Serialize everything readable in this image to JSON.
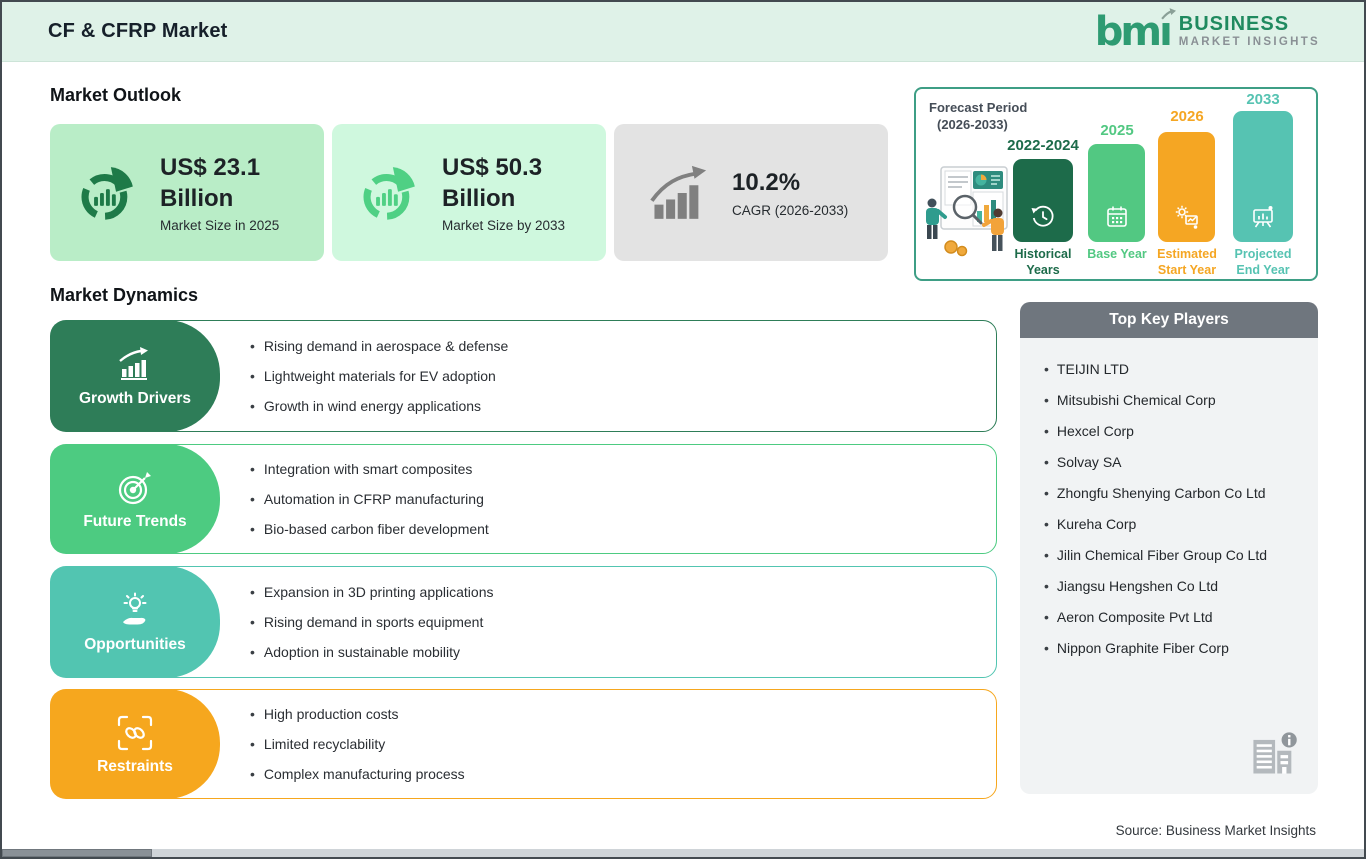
{
  "header": {
    "title": "CF & CFRP Market",
    "logo": {
      "mark": "bm",
      "mark_i": "ı",
      "line1": "BUSINESS",
      "line2": "MARKET INSIGHTS"
    }
  },
  "market_outlook": {
    "heading": "Market Outlook",
    "cards": [
      {
        "value": "US$ 23.1 Billion",
        "label": "Market Size in 2025",
        "bg": "#B9EDC7",
        "icon": "donut-bars-icon",
        "icon_color": "#1E7A48"
      },
      {
        "value": "US$ 50.3 Billion",
        "label": "Market Size by 2033",
        "bg": "#CFF8DE",
        "icon": "donut-bars-icon",
        "icon_color": "#4FD084"
      },
      {
        "value": "10.2%",
        "label": "CAGR (2026-2033)",
        "bg": "#E3E3E3",
        "icon": "growth-arrow-icon",
        "icon_color": "#808080"
      }
    ]
  },
  "forecast_panel": {
    "title_line1": "Forecast Period",
    "title_line2": "(2026-2033)",
    "bars": [
      {
        "year": "2022-2024",
        "label": "Historical Years",
        "color": "#1D6B4A",
        "icon": "history-clock-icon"
      },
      {
        "year": "2025",
        "label": "Base Year",
        "color": "#52C882",
        "icon": "calendar-icon"
      },
      {
        "year": "2026",
        "label": "Estimated Start Year",
        "color": "#F5A623",
        "icon": "estimate-icon"
      },
      {
        "year": "2033",
        "label": "Projected End Year",
        "color": "#56C3B2",
        "icon": "presentation-icon"
      }
    ]
  },
  "market_dynamics": {
    "heading": "Market Dynamics",
    "rows": [
      {
        "label": "Growth Drivers",
        "color": "#2E7D58",
        "icon": "growth-chart-icon",
        "bullets": [
          "Rising demand in aerospace & defense",
          "Lightweight materials for EV adoption",
          "Growth in wind energy applications"
        ]
      },
      {
        "label": "Future Trends",
        "color": "#4DCB81",
        "icon": "target-icon",
        "bullets": [
          "Integration with smart composites",
          "Automation in CFRP manufacturing",
          "Bio-based carbon fiber development"
        ]
      },
      {
        "label": "Opportunities",
        "color": "#52C5B1",
        "icon": "bulb-hand-icon",
        "bullets": [
          "Expansion in 3D printing applications",
          "Rising demand in sports equipment",
          "Adoption in sustainable mobility"
        ]
      },
      {
        "label": "Restraints",
        "color": "#F6A71E",
        "icon": "chain-icon",
        "bullets": [
          "High production costs",
          "Limited recyclability",
          "Complex manufacturing process"
        ]
      }
    ]
  },
  "key_players": {
    "heading": "Top Key Players",
    "items": [
      "TEIJIN LTD",
      "Mitsubishi Chemical Corp",
      "Hexcel Corp",
      "Solvay SA",
      "Zhongfu Shenying Carbon Co Ltd",
      "Kureha Corp",
      "Jilin Chemical Fiber Group Co Ltd",
      "Jiangsu Hengshen Co Ltd",
      "Aeron Composite Pvt Ltd",
      "Nippon Graphite Fiber Corp"
    ]
  },
  "source": "Source: Business Market Insights",
  "colors": {
    "header_bg": "#DFF2E8",
    "players_header_bg": "#6F767E",
    "players_body_bg": "#F1F3F4",
    "panel_border": "#3E9E85"
  }
}
